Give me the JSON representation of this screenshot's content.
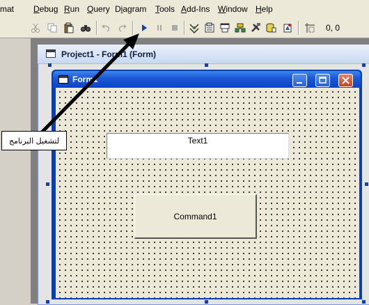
{
  "menu": [
    {
      "label": "mat",
      "ul": ""
    },
    {
      "label": "Debug",
      "ul": "D"
    },
    {
      "label": "Run",
      "ul": "R"
    },
    {
      "label": "Query",
      "ul": "Q"
    },
    {
      "label": "Diagram",
      "ul": "i"
    },
    {
      "label": "Tools",
      "ul": "T"
    },
    {
      "label": "Add-Ins",
      "ul": "A"
    },
    {
      "label": "Window",
      "ul": "W"
    },
    {
      "label": "Help",
      "ul": "H"
    }
  ],
  "toolbar": {
    "icons": [
      "cut-icon",
      "copy-icon",
      "paste-icon",
      "find-icon",
      "undo-icon",
      "redo-icon",
      "start-icon",
      "break-icon",
      "end-icon",
      "project-explorer-icon",
      "properties-icon",
      "form-layout-icon",
      "object-browser-icon",
      "toolbox-icon",
      "data-view-icon",
      "component-manager-icon",
      "position-icon"
    ],
    "coords": "0, 0"
  },
  "designer": {
    "title": "Project1 - Form1 (Form)"
  },
  "form": {
    "title": "Form1",
    "textbox": "Text1",
    "command": "Command1"
  },
  "annotation": {
    "text": "لتشغيل البرنامج"
  },
  "colors": {
    "titlebar": "#1d5ad6",
    "close": "#c9401e",
    "face": "#ece9d8"
  }
}
